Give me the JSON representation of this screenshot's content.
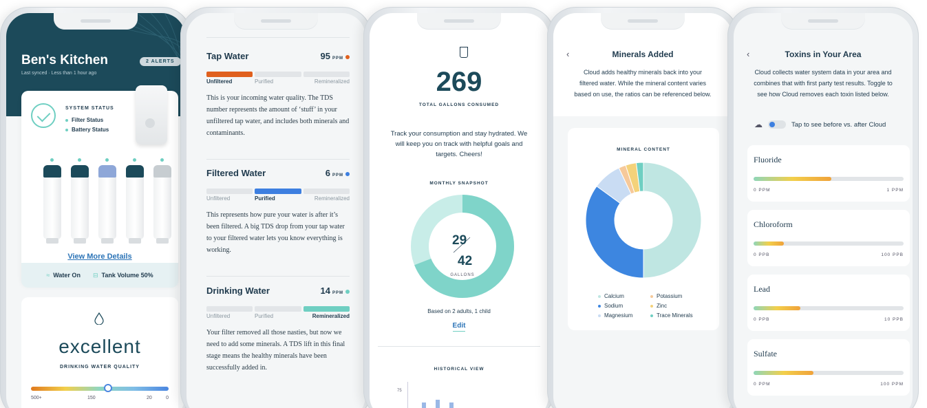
{
  "colors": {
    "navy": "#1c4a5a",
    "teal": "#6fcfc2",
    "blue": "#2c74b7",
    "orange": "#e0601e",
    "accentBlue": "#3d7fe0"
  },
  "phone1": {
    "title": "Ben's Kitchen",
    "subtitle": "Last synced · Less than 1 hour ago",
    "alerts": "2 ALERTS",
    "system_status_heading": "SYSTEM STATUS",
    "status_items": [
      "Filter Status",
      "Battery Status"
    ],
    "view_more": "View More Details",
    "water_on": "Water On",
    "tank_volume": "Tank Volume 50%",
    "quality_word": "excellent",
    "quality_caption": "DRINKING WATER QUALITY",
    "quality_level": 0.56,
    "scale_labels": [
      "500+",
      "150",
      "20",
      "0"
    ],
    "filter_caps": [
      "#1c4a5a",
      "#1c4a5a",
      "#8ea7d8",
      "#1c4a5a",
      "#c7cdd1"
    ]
  },
  "phone2": {
    "sections": [
      {
        "name": "Tap Water",
        "value": "95",
        "unit": "PPM",
        "dot": "#e0601e",
        "active": 0,
        "fill": "#e0601e",
        "steps": [
          "Unfiltered",
          "Purified",
          "Remineralized"
        ],
        "text": "This is your incoming water quality. The TDS number represents the amount of ‘stuff’ in your unfiltered tap water, and includes both minerals and contaminants."
      },
      {
        "name": "Filtered Water",
        "value": "6",
        "unit": "PPM",
        "dot": "#3d7fe0",
        "active": 1,
        "fill": "#3d7fe0",
        "steps": [
          "Unfiltered",
          "Purified",
          "Remineralized"
        ],
        "text": "This represents how pure your water is after it’s been filtered.  A big TDS drop from your tap water to your filtered water lets you know everything is working."
      },
      {
        "name": "Drinking Water",
        "value": "14",
        "unit": "PPM",
        "dot": "#6fcfc2",
        "active": 2,
        "fill": "#6fcfc2",
        "steps": [
          "Unfiltered",
          "Purified",
          "Remineralized"
        ],
        "text": "Your filter removed all those nasties, but now we need to add some minerals. A TDS lift in this final stage means the healthy minerals have been successfully added in."
      }
    ]
  },
  "phone3": {
    "total": "269",
    "total_caption": "TOTAL GALLONS CONSUMED",
    "message": "Track your consumption and stay hydrated. We will keep you on track with helpful goals and targets. Cheers!",
    "snapshot_heading": "MONTHLY SNAPSHOT",
    "consumed": "29",
    "goal": "42",
    "unit": "GALLONS",
    "household": "Based on 2 adults, 1 child",
    "edit": "Edit",
    "historical_heading": "HISTORICAL VIEW",
    "axis_tick": "75"
  },
  "phone4": {
    "back": "‹",
    "title": "Minerals Added",
    "description": "Cloud adds healthy minerals back into your filtered water. While the mineral content varies based on use, the ratios can be referenced below.",
    "card_heading": "MINERAL CONTENT"
  },
  "chart_data": {
    "type": "pie",
    "title": "MINERAL CONTENT",
    "categories": [
      "Calcium",
      "Sodium",
      "Magnesium",
      "Potassium",
      "Zinc",
      "Trace Minerals"
    ],
    "values": [
      50,
      35,
      8,
      2,
      3,
      2
    ],
    "colors": [
      "#bfe6e2",
      "#3d86e0",
      "#c9dcf3",
      "#f6c99a",
      "#f4d27a",
      "#6fcfc2"
    ],
    "legend_position": "bottom"
  },
  "phone5": {
    "back": "‹",
    "title": "Toxins in Your Area",
    "description": "Cloud collects water system data in your area and combines that with first party test results. Toggle to see how Cloud removes each toxin listed below.",
    "toggle_label": "Tap to see before vs. after Cloud",
    "toxins": [
      {
        "name": "Fluoride",
        "min": "0 PPM",
        "max": "1 PPM",
        "level": 0.52
      },
      {
        "name": "Chloroform",
        "min": "0 PPB",
        "max": "100 PPB",
        "level": 0.2
      },
      {
        "name": "Lead",
        "min": "0 PPB",
        "max": "10 PPB",
        "level": 0.31
      },
      {
        "name": "Sulfate",
        "min": "0 PPM",
        "max": "100 PPM",
        "level": 0.4
      }
    ]
  }
}
